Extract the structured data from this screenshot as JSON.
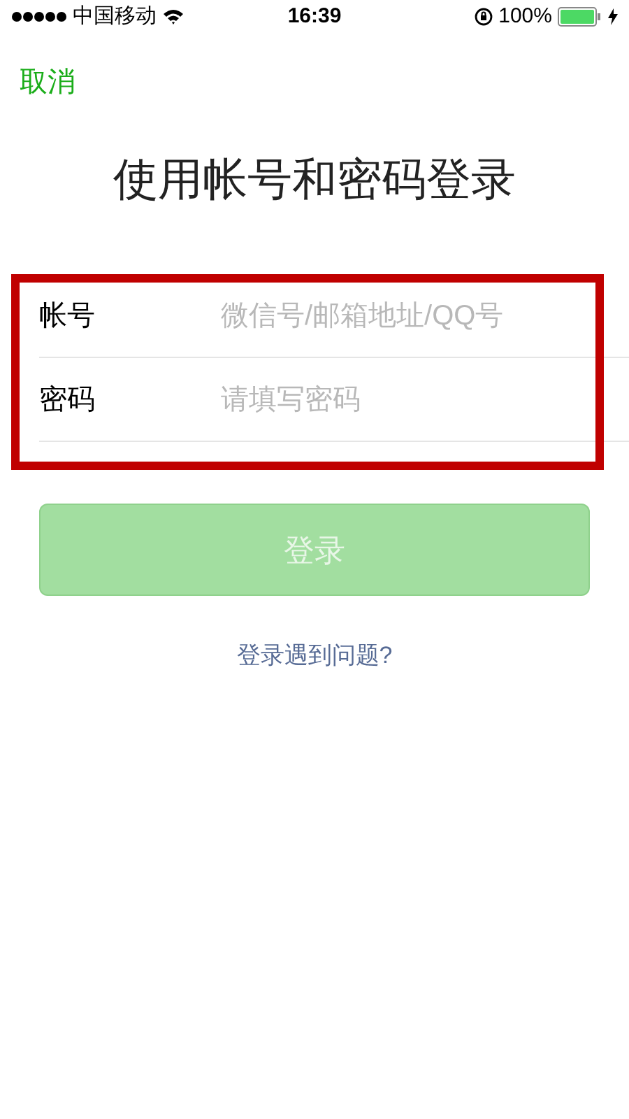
{
  "status_bar": {
    "carrier": "中国移动",
    "time": "16:39",
    "battery": "100%"
  },
  "cancel": "取消",
  "title": "使用帐号和密码登录",
  "form": {
    "highlighted": true,
    "fields": [
      {
        "label": "帐号",
        "placeholder": "微信号/邮箱地址/QQ号"
      },
      {
        "label": "密码",
        "placeholder": "请填写密码"
      }
    ]
  },
  "login_button": {
    "label": "登录",
    "disabled": true
  },
  "help_link": "登录遇到问题?"
}
